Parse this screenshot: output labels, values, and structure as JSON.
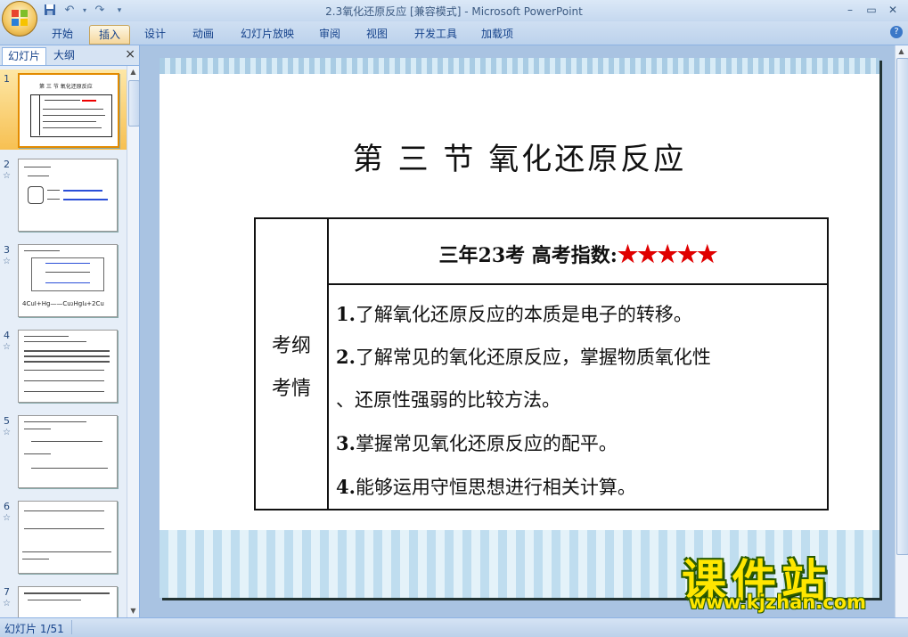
{
  "window": {
    "title": "2.3氧化还原反应 [兼容模式] - Microsoft PowerPoint",
    "controls": {
      "minimize": "–",
      "restore": "▭",
      "close": "✕"
    }
  },
  "quick_access": {
    "icons": [
      "save-icon",
      "undo-icon",
      "redo-icon",
      "customize-icon"
    ]
  },
  "ribbon": {
    "tabs": [
      "开始",
      "插入",
      "设计",
      "动画",
      "幻灯片放映",
      "审阅",
      "视图",
      "开发工具",
      "加载项"
    ],
    "active_tab": "插入",
    "help": "?"
  },
  "panel": {
    "tabs": [
      "幻灯片",
      "大纲"
    ],
    "close": "×",
    "thumbnails": [
      {
        "num": "1",
        "star": "",
        "text": "第 三 节    氧化还原反应"
      },
      {
        "num": "2",
        "star": "☆",
        "text": ""
      },
      {
        "num": "3",
        "star": "☆",
        "text": "4CuI+Hg——Cu₂HgI₄+2Cu"
      },
      {
        "num": "4",
        "star": "☆",
        "text": ""
      },
      {
        "num": "5",
        "star": "☆",
        "text": ""
      },
      {
        "num": "6",
        "star": "☆",
        "text": ""
      },
      {
        "num": "7",
        "star": "☆",
        "text": ""
      }
    ]
  },
  "slide": {
    "title": "第 三 节    氧化还原反应",
    "left_label": [
      "考纲",
      "考情"
    ],
    "header_text": "三年23考   高考指数:",
    "header_stars": "★★★★★",
    "items": [
      {
        "num": "1.",
        "text": "了解氧化还原反应的本质是电子的转移。"
      },
      {
        "num": "2.",
        "text": "了解常见的氧化还原反应，掌握物质氧化性"
      },
      {
        "num": "",
        "text": "、还原性强弱的比较方法。"
      },
      {
        "num": "3.",
        "text": "掌握常见氧化还原反应的配平。"
      },
      {
        "num": "4.",
        "text": "能够运用守恒思想进行相关计算。"
      }
    ]
  },
  "watermark": {
    "cn": "课件站",
    "url": "www.kjzhan.com"
  },
  "status": {
    "text": "幻灯片 1/51"
  }
}
